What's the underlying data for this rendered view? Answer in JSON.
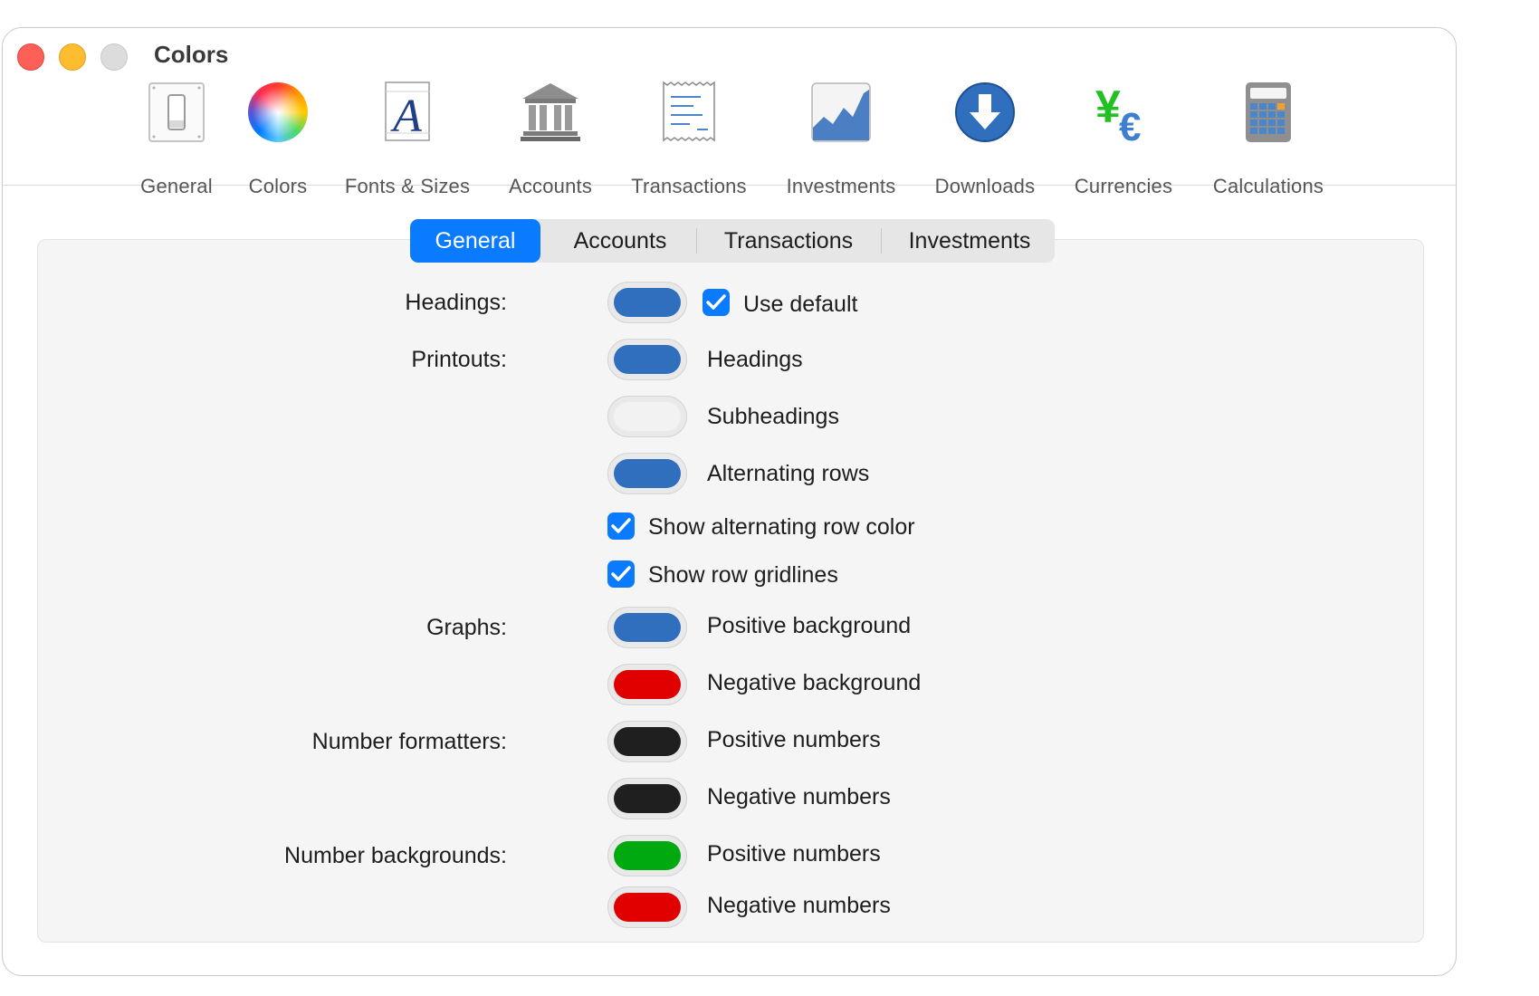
{
  "window": {
    "title": "Colors"
  },
  "toolbar": {
    "items": [
      {
        "label": "General",
        "icon": "general-switch-icon"
      },
      {
        "label": "Colors",
        "icon": "color-wheel-icon"
      },
      {
        "label": "Fonts & Sizes",
        "icon": "font-a-icon"
      },
      {
        "label": "Accounts",
        "icon": "bank-building-icon"
      },
      {
        "label": "Transactions",
        "icon": "receipt-icon"
      },
      {
        "label": "Investments",
        "icon": "area-chart-icon"
      },
      {
        "label": "Downloads",
        "icon": "download-arrow-icon"
      },
      {
        "label": "Currencies",
        "icon": "yen-euro-icon"
      },
      {
        "label": "Calculations",
        "icon": "calculator-icon"
      }
    ],
    "selected": "Colors"
  },
  "tabs": {
    "items": [
      "General",
      "Accounts",
      "Transactions",
      "Investments"
    ],
    "selected": "General"
  },
  "settings": {
    "headings": {
      "label": "Headings:",
      "color": "#2f6fbe",
      "use_default": {
        "label": "Use default",
        "checked": true
      }
    },
    "printouts": {
      "label": "Printouts:",
      "rows": [
        {
          "label": "Headings",
          "color": "#2f6fbe"
        },
        {
          "label": "Subheadings",
          "color": "#f2f2f2"
        },
        {
          "label": "Alternating rows",
          "color": "#2f6fbe"
        }
      ],
      "show_alternating": {
        "label": "Show alternating row color",
        "checked": true
      },
      "show_gridlines": {
        "label": "Show row gridlines",
        "checked": true
      }
    },
    "graphs": {
      "label": "Graphs:",
      "rows": [
        {
          "label": "Positive background",
          "color": "#2f6fbe"
        },
        {
          "label": "Negative background",
          "color": "#e00000"
        }
      ]
    },
    "number_formatters": {
      "label": "Number formatters:",
      "rows": [
        {
          "label": "Positive numbers",
          "color": "#1f1f1f"
        },
        {
          "label": "Negative numbers",
          "color": "#1f1f1f"
        }
      ]
    },
    "number_backgrounds": {
      "label": "Number backgrounds:",
      "rows": [
        {
          "label": "Positive numbers",
          "color": "#00a90f"
        },
        {
          "label": "Negative numbers",
          "color": "#e00000"
        }
      ]
    }
  },
  "colors": {
    "accent": "#0a7aff"
  }
}
